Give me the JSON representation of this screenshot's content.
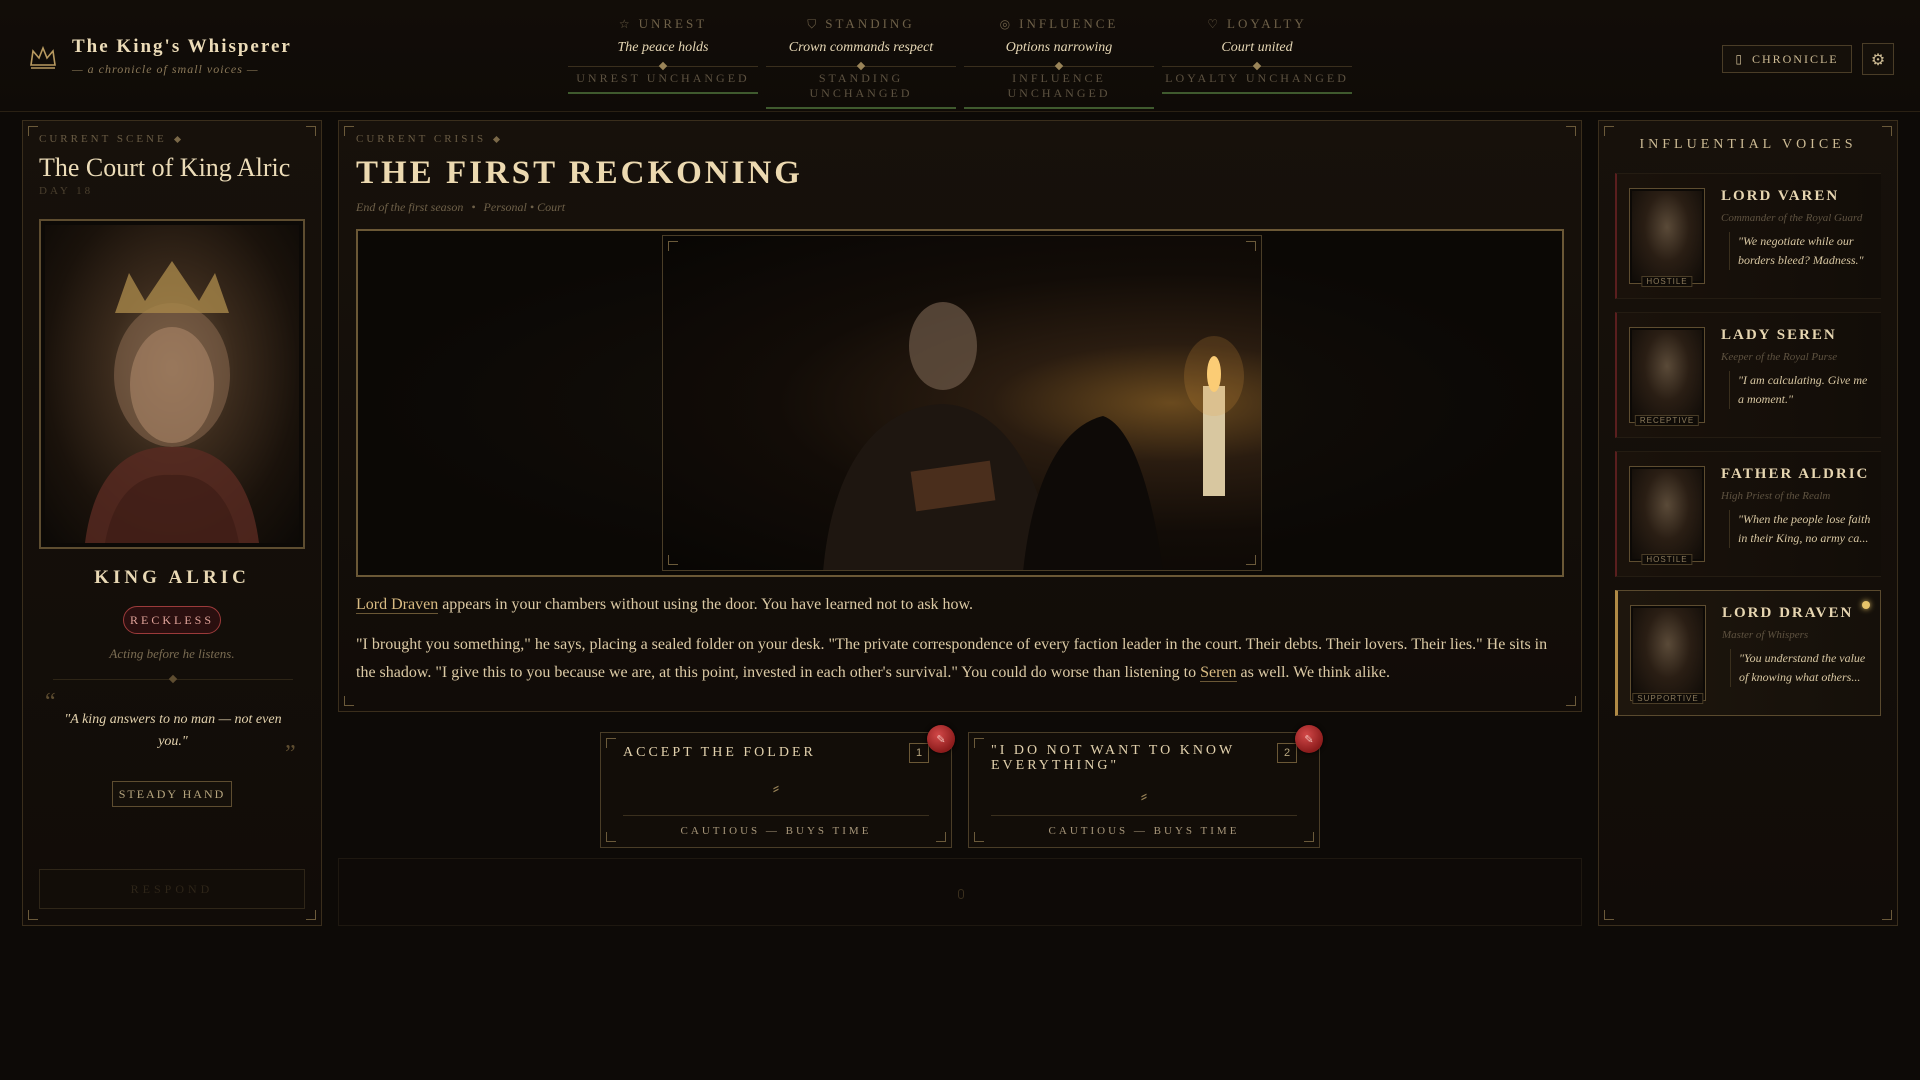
{
  "brand": {
    "title": "The King's Whisperer",
    "subtitle": "— a chronicle of small voices —",
    "icon": "crown-icon"
  },
  "stats": [
    {
      "label": "Unrest",
      "icon": "star-icon",
      "value": "The peace holds",
      "change": "Unrest unchanged"
    },
    {
      "label": "Standing",
      "icon": "shield-icon",
      "value": "Crown commands respect",
      "change": "Standing unchanged"
    },
    {
      "label": "Influence",
      "icon": "eye-icon",
      "value": "Options narrowing",
      "change": "Influence unchanged"
    },
    {
      "label": "Loyalty",
      "icon": "heart-icon",
      "value": "Court united",
      "change": "Loyalty unchanged"
    }
  ],
  "header_buttons": {
    "chronicle_label": "Chronicle",
    "chronicle_icon": "book-icon",
    "settings_icon": "gear-icon"
  },
  "scene": {
    "eyebrow": "Current Scene",
    "title": "The Court of King Alric",
    "day": "DAY 18",
    "king_name": "King Alric",
    "trait": "Reckless",
    "trait_desc": "Acting before he listens.",
    "quote": "\"A king answers to no man — not even you.\"",
    "quote_open": "“",
    "quote_close": "”",
    "action_label": "Steady Hand",
    "resolve_label": "Respond"
  },
  "crisis": {
    "eyebrow": "Current Crisis",
    "title": "The First Reckoning",
    "meta_time": "End of the first season",
    "meta_sep": "•",
    "meta_tags": "Personal • Court",
    "narrative_1_link": "Lord Draven",
    "narrative_1_rest": " appears in your chambers without using the door. You have learned not to ask how.",
    "narrative_2_main": "\"I brought you something,\" he says, placing a sealed folder on your desk. \"The private correspondence of every faction leader in the court. Their debts. Their lovers. Their lies.\" He sits in the shadow. \"I give this to you because we are, at this point, invested in each other's survival.\" You could do worse than listening to ",
    "narrative_2_link": "Seren",
    "narrative_2_end": " as well. We think alike."
  },
  "choices": [
    {
      "title": "Accept the folder",
      "number": "1",
      "effect": "Cautious — Buys time",
      "icon": "quill-icon"
    },
    {
      "title": "\"I do not want to know everything\"",
      "number": "2",
      "effect": "Cautious — Buys time",
      "icon": "quill-icon"
    }
  ],
  "voices": {
    "title": "Influential Voices",
    "items": [
      {
        "name": "Lord Varen",
        "role": "Commander of the Royal Guard",
        "quote": "\"We negotiate while our borders bleed? Madness.\"",
        "status": "Hostile"
      },
      {
        "name": "Lady Seren",
        "role": "Keeper of the Royal Purse",
        "quote": "\"I am calculating. Give me a moment.\"",
        "status": "Receptive"
      },
      {
        "name": "Father Aldric",
        "role": "High Priest of the Realm",
        "quote": "\"When the people lose faith in their King, no army ca...",
        "status": "Hostile"
      },
      {
        "name": "Lord Draven",
        "role": "Master of Whispers",
        "quote": "\"You understand the value of knowing what others...",
        "status": "Supportive"
      }
    ]
  },
  "colors": {
    "background": "#0d0a07",
    "gold": "#d9bb82",
    "hostile": "#5a1e1e",
    "supportive": "#b08a45",
    "seal": "#c23a3a",
    "reckless": "#9c3a3a"
  }
}
